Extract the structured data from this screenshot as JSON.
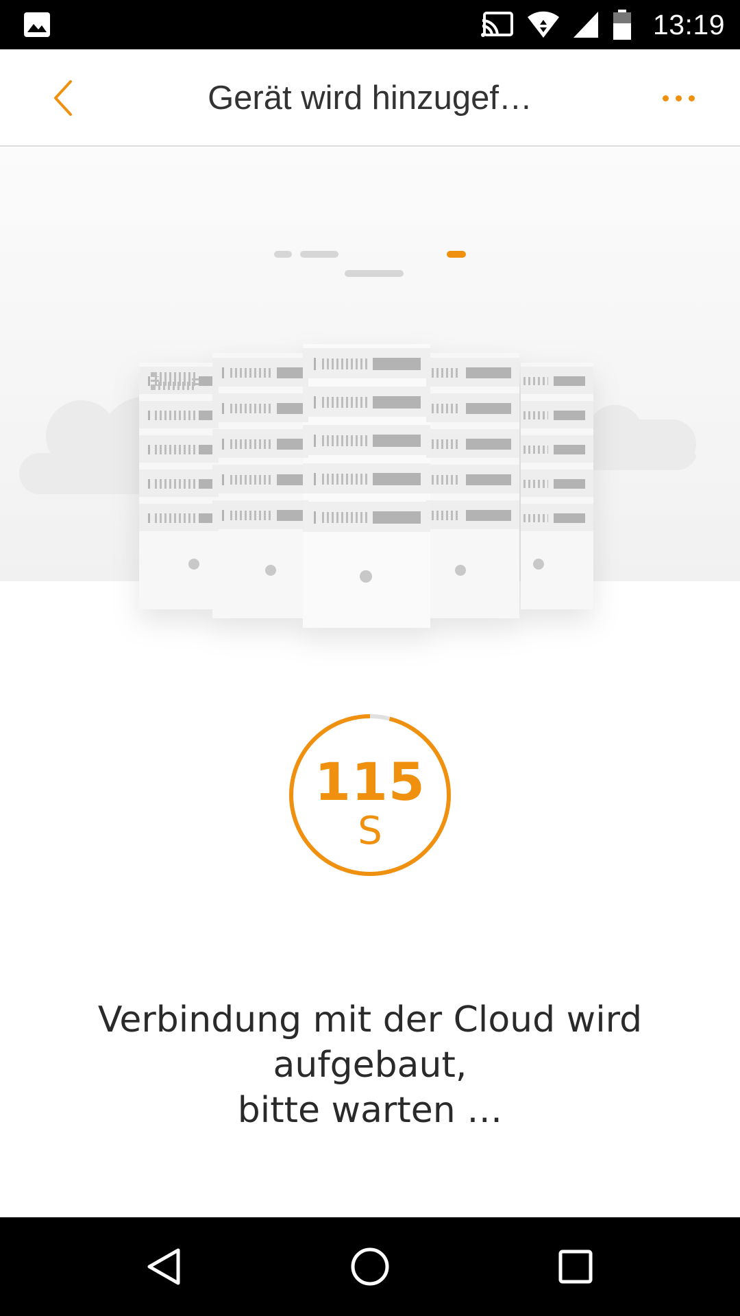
{
  "status_bar": {
    "time": "13:19",
    "icons": [
      "image-notification-icon",
      "cast-icon",
      "wifi-icon",
      "signal-icon",
      "battery-icon"
    ]
  },
  "app_bar": {
    "title": "Gerät wird hinzugef…",
    "back_icon": "chevron-left-icon",
    "more_icon": "more-dots-icon",
    "accent_color": "#f0900f"
  },
  "illustration": {
    "subject": "servers-cloud-icon",
    "progress_dots": 4,
    "active_dot_index": 3
  },
  "timer": {
    "value": "115",
    "unit": "S",
    "progress_fraction": 0.96,
    "color": "#f0900f",
    "track_color": "#e0e0e0"
  },
  "message": {
    "line1": "Verbindung mit der Cloud wird aufgebaut,",
    "line2": "bitte warten …"
  },
  "nav_bar": {
    "buttons": [
      "back-triangle-icon",
      "home-circle-icon",
      "recents-square-icon"
    ]
  }
}
